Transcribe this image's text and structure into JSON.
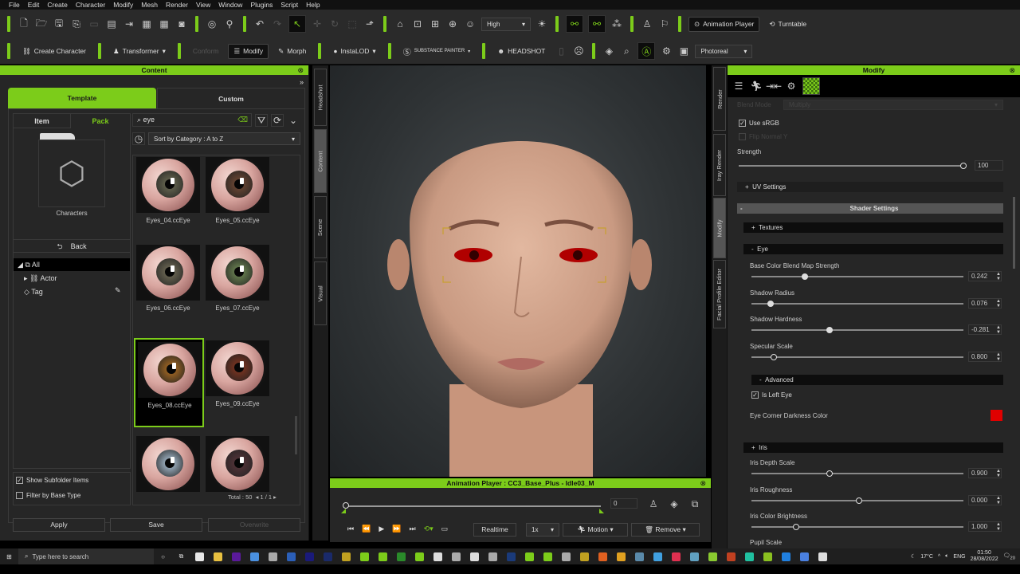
{
  "menu": [
    "File",
    "Edit",
    "Create",
    "Character",
    "Modify",
    "Mesh",
    "Render",
    "View",
    "Window",
    "Plugins",
    "Script",
    "Help"
  ],
  "toolbar1": {
    "quality": "High",
    "animation_player": "Animation Player",
    "turntable": "Turntable"
  },
  "toolbar2": {
    "create_character": "Create Character",
    "transformer": "Transformer",
    "conform": "Conform",
    "modify": "Modify",
    "morph": "Morph",
    "instalod": "InstaLOD",
    "substance": "SUBSTANCE PAINTER",
    "headshot": "HEADSHOT",
    "render_mode": "Photoreal"
  },
  "content": {
    "title": "Content",
    "tabs": [
      "Template",
      "Custom"
    ],
    "subtabs": [
      "Item",
      "Pack"
    ],
    "folder": "Characters",
    "back": "Back",
    "tree": [
      "All",
      "Actor",
      "Tag"
    ],
    "search": "eye",
    "sort": "Sort by Category : A to Z",
    "items": [
      {
        "name": "Eyes_04.ccEye",
        "iris": "#5a5a48"
      },
      {
        "name": "Eyes_05.ccEye",
        "iris": "#5e4030"
      },
      {
        "name": "Eyes_06.ccEye",
        "iris": "#5e5a4a"
      },
      {
        "name": "Eyes_07.ccEye",
        "iris": "#5c7048"
      },
      {
        "name": "Eyes_08.ccEye",
        "iris": "#8a5a22",
        "selected": true
      },
      {
        "name": "Eyes_09.ccEye",
        "iris": "#6a3020"
      },
      {
        "name": "",
        "iris": "#8a9aa8"
      },
      {
        "name": "",
        "iris": "#4a3034"
      }
    ],
    "show_subfolder": "Show Subfolder Items",
    "filter_base": "Filter by Base Type",
    "total": "Total : 50",
    "page": "1",
    "pages": "1",
    "apply": "Apply",
    "save": "Save",
    "overwrite": "Overwrite"
  },
  "left_tabs": [
    "Headshot",
    "Content",
    "Scene",
    "Visual"
  ],
  "right_tabs": [
    "Render",
    "Iray Render",
    "Modify",
    "Facial Profile Editor"
  ],
  "anim": {
    "title": "Animation Player : CC3_Base_Plus - Idle03_M",
    "frame": "0",
    "realtime": "Realtime",
    "speed": "1x",
    "motion": "Motion",
    "remove": "Remove",
    "progress": 0
  },
  "modify": {
    "title": "Modify",
    "blend_mode_label": "Blend Mode",
    "blend_mode": "Multiply",
    "use_srgb": "Use sRGB",
    "flip_normal": "Flip Normal Y",
    "strength_label": "Strength",
    "strength": "100",
    "uv_settings": "UV Settings",
    "shader_settings": "Shader Settings",
    "textures": "Textures",
    "eye": "Eye",
    "sliders1": [
      {
        "label": "Base Color Blend Map Strength",
        "value": "0.242",
        "pos": 0.242
      },
      {
        "label": "Shadow Radius",
        "value": "0.076",
        "pos": 0.076
      },
      {
        "label": "Shadow Hardness",
        "value": "-0.281",
        "pos": 0.36
      },
      {
        "label": "Specular Scale",
        "value": "0.800",
        "pos": 0.09
      }
    ],
    "advanced": "Advanced",
    "is_left_eye": "Is Left Eye",
    "eye_corner_label": "Eye Corner Darkness Color",
    "eye_corner_color": "#e00000",
    "iris": "Iris",
    "sliders2": [
      {
        "label": "Iris Depth Scale",
        "value": "0.900",
        "pos": 0.36
      },
      {
        "label": "Iris Roughness",
        "value": "0.000",
        "pos": 0.5
      },
      {
        "label": "Iris Color Brightness",
        "value": "1.000",
        "pos": 0.2
      }
    ],
    "pupil_scale": "Pupil Scale"
  },
  "taskbar": {
    "search": "Type here to search",
    "weather": "17°C",
    "lang": "ENG",
    "time": "01:50",
    "date": "28/08/2022",
    "notif": "20"
  },
  "colors": {
    "accent": "#7ccc1a"
  }
}
